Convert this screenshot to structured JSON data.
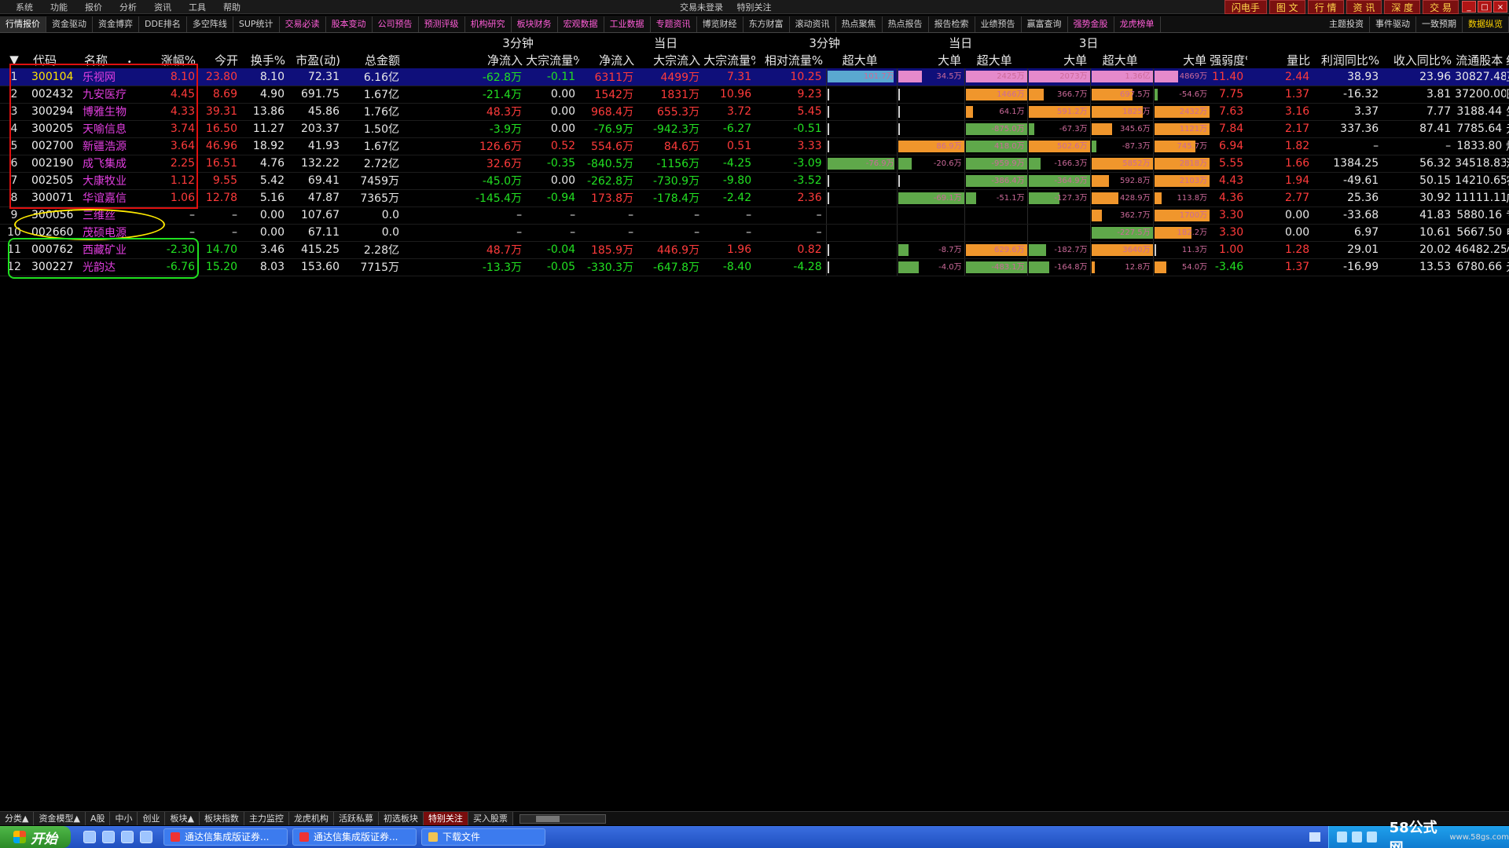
{
  "menu": [
    "系统",
    "功能",
    "报价",
    "分析",
    "资讯",
    "工具",
    "帮助"
  ],
  "center_status": [
    "交易未登录",
    "特别关注"
  ],
  "right_buttons": [
    "闪电手",
    "图 文",
    "行 情",
    "资 讯",
    "深 度",
    "交 易"
  ],
  "window_controls": [
    "_",
    "□",
    "×"
  ],
  "top_tabs": [
    {
      "label": "行情报价",
      "style": "active"
    },
    {
      "label": "资金驱动",
      "style": ""
    },
    {
      "label": "资金博弈",
      "style": ""
    },
    {
      "label": "DDE排名",
      "style": ""
    },
    {
      "label": "多空阵线",
      "style": ""
    },
    {
      "label": "SUP统计",
      "style": ""
    },
    {
      "label": "交易必读",
      "style": "pink"
    },
    {
      "label": "股本变动",
      "style": "pink"
    },
    {
      "label": "公司预告",
      "style": "pink"
    },
    {
      "label": "预测评级",
      "style": "pink"
    },
    {
      "label": "机构研究",
      "style": "pink"
    },
    {
      "label": "板块财务",
      "style": "pink"
    },
    {
      "label": "宏观数据",
      "style": "pink"
    },
    {
      "label": "工业数据",
      "style": "pink"
    },
    {
      "label": "专题资讯",
      "style": "pink"
    },
    {
      "label": "博览财经",
      "style": ""
    },
    {
      "label": "东方财富",
      "style": ""
    },
    {
      "label": "滚动资讯",
      "style": ""
    },
    {
      "label": "热点聚焦",
      "style": ""
    },
    {
      "label": "热点报告",
      "style": ""
    },
    {
      "label": "报告检索",
      "style": ""
    },
    {
      "label": "业绩预告",
      "style": ""
    },
    {
      "label": "赢富查询",
      "style": ""
    },
    {
      "label": "强势金股",
      "style": "pink"
    },
    {
      "label": "龙虎榜单",
      "style": "pink"
    }
  ],
  "top_tabs_right": [
    {
      "label": "主题投资",
      "style": ""
    },
    {
      "label": "事件驱动",
      "style": ""
    },
    {
      "label": "一致预期",
      "style": ""
    },
    {
      "label": "数据纵览",
      "style": "pink"
    }
  ],
  "header": {
    "grp_3min": "3分钟",
    "grp_today": "当日",
    "grp_3min_b": "3分钟",
    "grp_today_b": "当日",
    "grp_3day": "3日",
    "cols": {
      "dropdown": "▼",
      "code": "代码",
      "name": "名称",
      "dot": "•",
      "chg": "涨幅%",
      "open": "今开",
      "turnover": "换手%",
      "pe": "市盈(动)",
      "amount": "总金额",
      "m3_net": "净流入",
      "m3_block": "大宗流量%",
      "d_net": "净流入",
      "d_block": "大宗流入",
      "d_blockpct": "大宗流量%",
      "d_rel": "相对流量%",
      "b_m3_super": "超大单",
      "b_m3_big": "大单",
      "b_d_super": "超大单",
      "b_d_big": "大单",
      "b_3d_super": "超大单",
      "b_3d_big": "大单",
      "strength": "强弱度%",
      "vol_ratio": "量比",
      "profit_yoy": "利润同比%",
      "rev_yoy": "收入同比%",
      "float": "流通股本",
      "industry": "细分行业"
    }
  },
  "rows": [
    {
      "idx": "1",
      "code": "300104",
      "name": "乐视网",
      "chg": "8.10",
      "open": "23.80",
      "turnover": "8.10",
      "pe": "72.31",
      "amount": "6.16亿",
      "m3_net": "-62.8万",
      "m3_block": "-0.11",
      "d_net": "6311万",
      "d_block": "4499万",
      "d_blockpct": "7.31",
      "d_rel": "10.25",
      "b1": "101.7万",
      "b2": "34.5万",
      "b3": "2425万",
      "b4": "2073万",
      "b5": "1.36亿",
      "b6": "4869万",
      "strength": "11.40",
      "vol_ratio": "2.44",
      "profit_yoy": "38.93",
      "rev_yoy": "23.96",
      "float": "30827.48",
      "industry": "互联网",
      "sel": true,
      "bars": [
        {
          "c": "blue",
          "w": 0.98
        },
        {
          "c": "pink",
          "w": 0.35
        },
        {
          "c": "pink",
          "w": 0.99
        },
        {
          "c": "pink",
          "w": 0.99
        },
        {
          "c": "pink",
          "w": 0.99
        },
        {
          "c": "pink",
          "w": 0.35
        }
      ]
    },
    {
      "idx": "2",
      "code": "002432",
      "name": "九安医疗",
      "chg": "4.45",
      "open": "8.69",
      "turnover": "4.90",
      "pe": "691.75",
      "amount": "1.67亿",
      "m3_net": "-21.4万",
      "m3_block": "0.00",
      "d_net": "1542万",
      "d_block": "1831万",
      "d_blockpct": "10.96",
      "d_rel": "9.23",
      "b1": "",
      "b2": "",
      "b3": "1466万",
      "b4": "366.7万",
      "b5": "697.5万",
      "b6": "-54.6万",
      "strength": "7.75",
      "vol_ratio": "1.37",
      "profit_yoy": "-16.32",
      "rev_yoy": "3.81",
      "float": "37200.00",
      "industry": "医疗保健",
      "bars": [
        {
          "c": "tick",
          "w": 0.02
        },
        {
          "c": "tick",
          "w": 0.02
        },
        {
          "c": "orange",
          "w": 0.98
        },
        {
          "c": "orange",
          "w": 0.22
        },
        {
          "c": "orange",
          "w": 0.6
        },
        {
          "c": "green",
          "w": 0.05
        }
      ]
    },
    {
      "idx": "3",
      "code": "300294",
      "name": "博雅生物",
      "chg": "4.33",
      "open": "39.31",
      "turnover": "13.86",
      "pe": "45.86",
      "amount": "1.76亿",
      "m3_net": "48.3万",
      "m3_block": "0.00",
      "d_net": "968.4万",
      "d_block": "655.3万",
      "d_blockpct": "3.72",
      "d_rel": "5.45",
      "b1": "",
      "b2": "",
      "b3": "64.1万",
      "b4": "591.2万",
      "b5": "1825万",
      "b6": "2432万",
      "strength": "7.63",
      "vol_ratio": "3.16",
      "profit_yoy": "3.37",
      "rev_yoy": "7.77",
      "float": "3188.44",
      "industry": "生物制药",
      "bars": [
        {
          "c": "tick",
          "w": 0.02
        },
        {
          "c": "tick",
          "w": 0.02
        },
        {
          "c": "orange",
          "w": 0.1
        },
        {
          "c": "orange",
          "w": 0.99
        },
        {
          "c": "orange",
          "w": 0.75
        },
        {
          "c": "orange",
          "w": 0.99
        }
      ]
    },
    {
      "idx": "4",
      "code": "300205",
      "name": "天喻信息",
      "chg": "3.74",
      "open": "16.50",
      "turnover": "11.27",
      "pe": "203.37",
      "amount": "1.50亿",
      "m3_net": "-3.9万",
      "m3_block": "0.00",
      "d_net": "-76.9万",
      "d_block": "-942.3万",
      "d_blockpct": "-6.27",
      "d_rel": "-0.51",
      "b1": "",
      "b2": "",
      "b3": "-875.0万",
      "b4": "-67.3万",
      "b5": "345.6万",
      "b6": "1121万",
      "strength": "7.84",
      "vol_ratio": "2.17",
      "profit_yoy": "337.36",
      "rev_yoy": "87.41",
      "float": "7785.64",
      "industry": "元器件",
      "bars": [
        {
          "c": "tick",
          "w": 0.02
        },
        {
          "c": "tick",
          "w": 0.02
        },
        {
          "c": "green",
          "w": 0.99
        },
        {
          "c": "green",
          "w": 0.08
        },
        {
          "c": "orange",
          "w": 0.3
        },
        {
          "c": "orange",
          "w": 0.85
        }
      ]
    },
    {
      "idx": "5",
      "code": "002700",
      "name": "新疆浩源",
      "chg": "3.64",
      "open": "46.96",
      "turnover": "18.92",
      "pe": "41.93",
      "amount": "1.67亿",
      "m3_net": "126.6万",
      "m3_block": "0.52",
      "d_net": "554.6万",
      "d_block": "84.6万",
      "d_blockpct": "0.51",
      "d_rel": "3.33",
      "b1": "",
      "b2": "86.9万",
      "b3": "418.0万",
      "b4": "502.6万",
      "b5": "-87.3万",
      "b6": "745.7万",
      "strength": "6.94",
      "vol_ratio": "1.82",
      "profit_yoy": "–",
      "rev_yoy": "–",
      "float": "1833.80",
      "industry": "燃气供热",
      "bars": [
        {
          "c": "tick",
          "w": 0.02
        },
        {
          "c": "orange",
          "w": 0.99
        },
        {
          "c": "green",
          "w": 0.99
        },
        {
          "c": "orange",
          "w": 0.99
        },
        {
          "c": "green",
          "w": 0.07
        },
        {
          "c": "orange",
          "w": 0.6
        }
      ]
    },
    {
      "idx": "6",
      "code": "002190",
      "name": "成飞集成",
      "chg": "2.25",
      "open": "16.51",
      "turnover": "4.76",
      "pe": "132.22",
      "amount": "2.72亿",
      "m3_net": "32.6万",
      "m3_block": "-0.35",
      "d_net": "-840.5万",
      "d_block": "-1156万",
      "d_blockpct": "-4.25",
      "d_rel": "-3.09",
      "b1": "-76.9万",
      "b2": "-20.6万",
      "b3": "-959.9万",
      "b4": "-166.3万",
      "b5": "5852万",
      "b6": "2818万",
      "strength": "5.55",
      "vol_ratio": "1.66",
      "profit_yoy": "1384.25",
      "rev_yoy": "56.32",
      "float": "34518.83",
      "industry": "汽车配件",
      "bars": [
        {
          "c": "green",
          "w": 0.99
        },
        {
          "c": "green",
          "w": 0.2
        },
        {
          "c": "green",
          "w": 0.99
        },
        {
          "c": "green",
          "w": 0.17
        },
        {
          "c": "orange",
          "w": 0.99
        },
        {
          "c": "orange",
          "w": 0.99
        }
      ]
    },
    {
      "idx": "7",
      "code": "002505",
      "name": "大康牧业",
      "chg": "1.12",
      "open": "9.55",
      "turnover": "5.42",
      "pe": "69.41",
      "amount": "7459万",
      "m3_net": "-45.0万",
      "m3_block": "0.00",
      "d_net": "-262.8万",
      "d_block": "-730.9万",
      "d_blockpct": "-9.80",
      "d_rel": "-3.52",
      "b1": "",
      "b2": "",
      "b3": "-386.4万",
      "b4": "-364.9万",
      "b5": "592.8万",
      "b6": "2103万",
      "strength": "4.43",
      "vol_ratio": "1.94",
      "profit_yoy": "-49.61",
      "rev_yoy": "50.15",
      "float": "14210.65",
      "industry": "农业综合",
      "bars": [
        {
          "c": "tick",
          "w": 0.02
        },
        {
          "c": "tick",
          "w": 0.02
        },
        {
          "c": "green",
          "w": 0.99
        },
        {
          "c": "green",
          "w": 0.99
        },
        {
          "c": "orange",
          "w": 0.25
        },
        {
          "c": "orange",
          "w": 0.9
        }
      ]
    },
    {
      "idx": "8",
      "code": "300071",
      "name": "华谊嘉信",
      "chg": "1.06",
      "open": "12.78",
      "turnover": "5.16",
      "pe": "47.87",
      "amount": "7365万",
      "m3_net": "-145.4万",
      "m3_block": "-0.94",
      "d_net": "173.8万",
      "d_block": "-178.4万",
      "d_blockpct": "-2.42",
      "d_rel": "2.36",
      "b1": "",
      "b2": "-69.1万",
      "b3": "-51.1万",
      "b4": "-127.3万",
      "b5": "428.9万",
      "b6": "113.8万",
      "strength": "4.36",
      "vol_ratio": "2.77",
      "profit_yoy": "25.36",
      "rev_yoy": "30.92",
      "float": "11111.11",
      "industry": "广告包装",
      "bars": [
        {
          "c": "tick",
          "w": 0.02
        },
        {
          "c": "green",
          "w": 0.99
        },
        {
          "c": "green",
          "w": 0.15
        },
        {
          "c": "green",
          "w": 0.45
        },
        {
          "c": "orange",
          "w": 0.4
        },
        {
          "c": "orange",
          "w": 0.1
        }
      ]
    },
    {
      "idx": "9",
      "code": "300056",
      "name": "三维丝",
      "chg": "–",
      "open": "–",
      "turnover": "0.00",
      "pe": "107.67",
      "amount": "0.0",
      "m3_net": "–",
      "m3_block": "–",
      "d_net": "–",
      "d_block": "–",
      "d_blockpct": "–",
      "d_rel": "–",
      "b1": "",
      "b2": "",
      "b3": "",
      "b4": "",
      "b5": "362.7万",
      "b6": "1700万",
      "strength": "3.30",
      "vol_ratio": "0.00",
      "profit_yoy": "-33.68",
      "rev_yoy": "41.83",
      "float": "5880.16",
      "industry": "专用机械",
      "bars": [
        {
          "c": "",
          "w": 0
        },
        {
          "c": "",
          "w": 0
        },
        {
          "c": "",
          "w": 0
        },
        {
          "c": "",
          "w": 0
        },
        {
          "c": "orange",
          "w": 0.15
        },
        {
          "c": "orange",
          "w": 0.99
        }
      ]
    },
    {
      "idx": "10",
      "code": "002660",
      "name": "茂硕电源",
      "chg": "–",
      "open": "–",
      "turnover": "0.00",
      "pe": "67.11",
      "amount": "0.0",
      "m3_net": "–",
      "m3_block": "–",
      "d_net": "–",
      "d_block": "–",
      "d_blockpct": "–",
      "d_rel": "–",
      "b1": "",
      "b2": "",
      "b3": "",
      "b4": "",
      "b5": "-227.5万",
      "b6": "182.2万",
      "strength": "3.30",
      "vol_ratio": "0.00",
      "profit_yoy": "6.97",
      "rev_yoy": "10.61",
      "float": "5667.50",
      "industry": "电气设备",
      "bars": [
        {
          "c": "",
          "w": 0
        },
        {
          "c": "",
          "w": 0
        },
        {
          "c": "",
          "w": 0
        },
        {
          "c": "",
          "w": 0
        },
        {
          "c": "green",
          "w": 0.99
        },
        {
          "c": "orange",
          "w": 0.55
        }
      ]
    },
    {
      "idx": "11",
      "code": "000762",
      "name": "西藏矿业",
      "chg": "-2.30",
      "open": "14.70",
      "turnover": "3.46",
      "pe": "415.25",
      "amount": "2.28亿",
      "m3_net": "48.7万",
      "m3_block": "-0.04",
      "d_net": "185.9万",
      "d_block": "446.9万",
      "d_blockpct": "1.96",
      "d_rel": "0.82",
      "b1": "",
      "b2": "-8.7万",
      "b3": "629.6万",
      "b4": "-182.7万",
      "b5": "3640万",
      "b6": "11.3万",
      "strength": "1.00",
      "vol_ratio": "1.28",
      "profit_yoy": "29.01",
      "rev_yoy": "20.02",
      "float": "46482.25",
      "industry": "小金属",
      "bars": [
        {
          "c": "tick",
          "w": 0.02
        },
        {
          "c": "green",
          "w": 0.15
        },
        {
          "c": "orange",
          "w": 0.99
        },
        {
          "c": "green",
          "w": 0.25
        },
        {
          "c": "orange",
          "w": 0.99
        },
        {
          "c": "tick",
          "w": 0.02
        }
      ]
    },
    {
      "idx": "12",
      "code": "300227",
      "name": "光韵达",
      "chg": "-6.76",
      "open": "15.20",
      "turnover": "8.03",
      "pe": "153.60",
      "amount": "7715万",
      "m3_net": "-13.3万",
      "m3_block": "-0.05",
      "d_net": "-330.3万",
      "d_block": "-647.8万",
      "d_blockpct": "-8.40",
      "d_rel": "-4.28",
      "b1": "",
      "b2": "-4.0万",
      "b3": "-483.1万",
      "b4": "-164.8万",
      "b5": "12.8万",
      "b6": "54.0万",
      "strength": "-3.46",
      "vol_ratio": "1.37",
      "profit_yoy": "-16.99",
      "rev_yoy": "13.53",
      "float": "6780.66",
      "industry": "元器件",
      "bars": [
        {
          "c": "tick",
          "w": 0.02
        },
        {
          "c": "green",
          "w": 0.3
        },
        {
          "c": "green",
          "w": 0.99
        },
        {
          "c": "green",
          "w": 0.3
        },
        {
          "c": "orange",
          "w": 0.05
        },
        {
          "c": "orange",
          "w": 0.18
        }
      ]
    }
  ],
  "bottom_tabs": [
    {
      "label": "分类▲",
      "active": false
    },
    {
      "label": "资金模型▲",
      "active": false
    },
    {
      "label": "A股",
      "active": false
    },
    {
      "label": "中小",
      "active": false
    },
    {
      "label": "创业",
      "active": false
    },
    {
      "label": "板块▲",
      "active": false
    },
    {
      "label": "板块指数",
      "active": false
    },
    {
      "label": "主力监控",
      "active": false
    },
    {
      "label": "龙虎机构",
      "active": false
    },
    {
      "label": "活跃私募",
      "active": false
    },
    {
      "label": "初选板块",
      "active": false
    },
    {
      "label": "特别关注",
      "active": true
    },
    {
      "label": "买入股票",
      "active": false
    }
  ],
  "taskbar": {
    "start": "开始",
    "windows": [
      "通达信集成版证券...",
      "通达信集成版证券...",
      "下载文件"
    ],
    "tray_logo": "58公式网",
    "tray_site": "www.58gs.com"
  },
  "colors": {
    "up": "#ff3b3b",
    "down": "#22e022",
    "name": "#e23ee0",
    "selected_row": "#0f0f7a"
  }
}
